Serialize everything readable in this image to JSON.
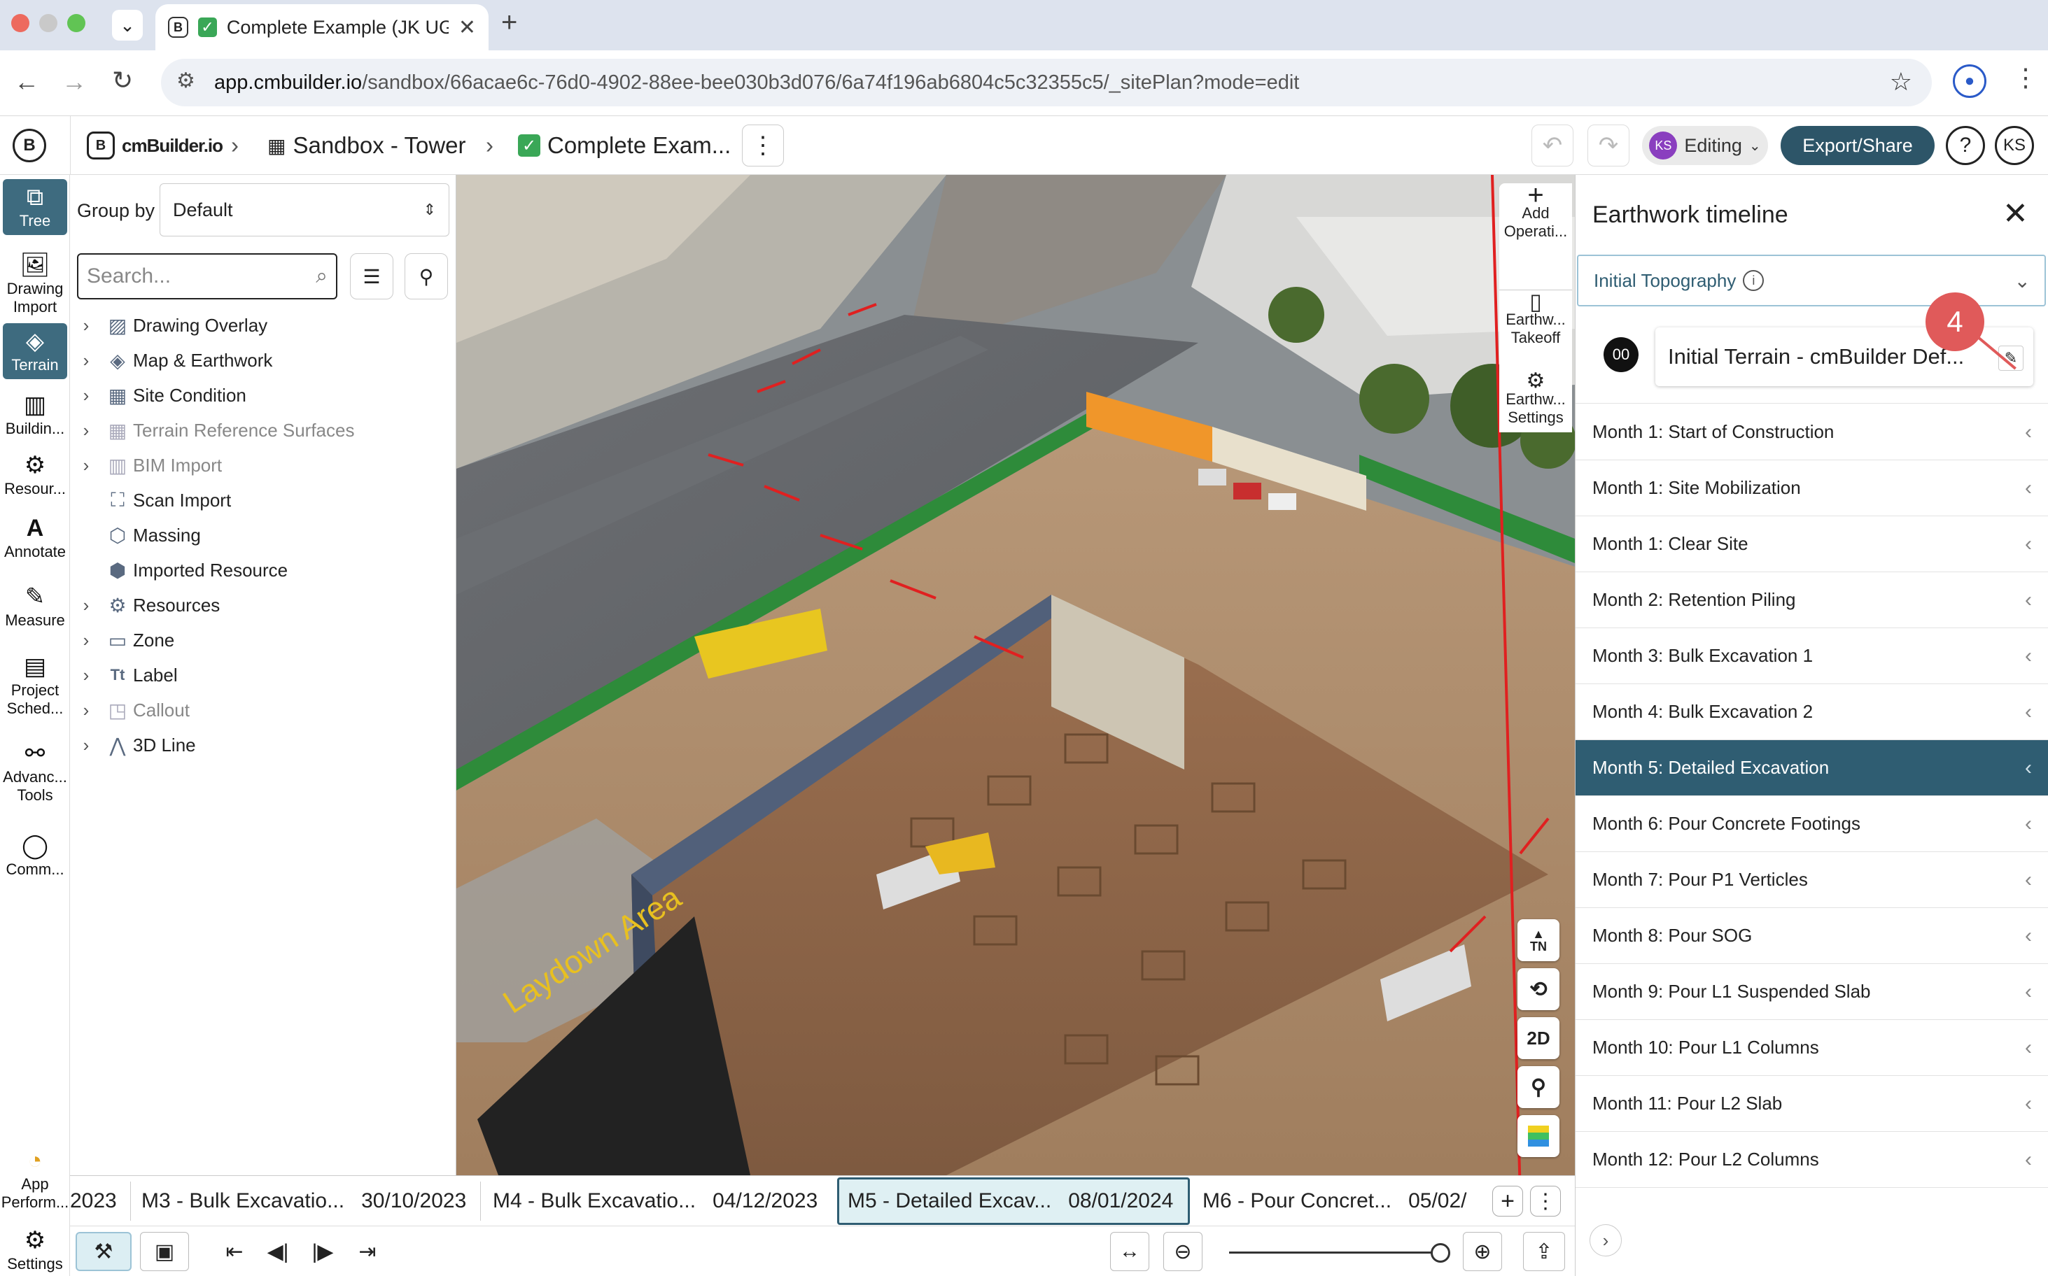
{
  "browser": {
    "tab_title": "Complete Example (JK UG",
    "new_tab": "+",
    "url_host": "app.cmbuilder.io",
    "url_path": "/sandbox/66acae6c-76d0-4902-88ee-bee030b3d076/6a74f196ab6804c5c32355c5/_sitePlan?mode=edit"
  },
  "header": {
    "logo": "cmBuilder.io",
    "crumbs": [
      "Sandbox - Tower",
      "Complete Exam..."
    ],
    "editing": "Editing",
    "avatar_ks": "KS",
    "export": "Export/Share",
    "help": "?",
    "user": "KS"
  },
  "rail": {
    "items": [
      {
        "label": "Tree"
      },
      {
        "label": "Drawing Import"
      },
      {
        "label": "Terrain"
      },
      {
        "label": "Buildin..."
      },
      {
        "label": "Resour..."
      },
      {
        "label": "Annotate"
      },
      {
        "label": "Measure"
      },
      {
        "label": "Project Sched..."
      },
      {
        "label": "Advanc... Tools"
      },
      {
        "label": "Comm..."
      }
    ],
    "app_perf": "App Perform...",
    "settings": "Settings"
  },
  "tree": {
    "groupby_label": "Group by",
    "groupby_value": "Default",
    "search_placeholder": "Search...",
    "items": [
      {
        "label": "Drawing Overlay"
      },
      {
        "label": "Map & Earthwork"
      },
      {
        "label": "Site Condition"
      },
      {
        "label": "Terrain Reference Surfaces"
      },
      {
        "label": "BIM Import"
      },
      {
        "label": "Scan Import"
      },
      {
        "label": "Massing"
      },
      {
        "label": "Imported Resource"
      },
      {
        "label": "Resources"
      },
      {
        "label": "Zone"
      },
      {
        "label": "Label"
      },
      {
        "label": "Callout"
      },
      {
        "label": "3D Line"
      }
    ]
  },
  "viewport": {
    "laydown": "Laydown Area",
    "tools": [
      {
        "label": "Add Operati..."
      },
      {
        "label": "Earthw... Takeoff"
      },
      {
        "label": "Earthw... Settings"
      }
    ],
    "north": "TN",
    "mode2d": "2D"
  },
  "panel": {
    "title": "Earthwork timeline",
    "dropdown": "Initial Topography",
    "badge": "00",
    "terrain_name": "Initial Terrain - cmBuilder Def...",
    "step_marker": "4",
    "months": [
      "Month 1: Start of Construction",
      "Month 1: Site Mobilization",
      "Month 1: Clear Site",
      "Month 2: Retention Piling",
      "Month 3: Bulk Excavation 1",
      "Month 4: Bulk Excavation 2",
      "Month 5: Detailed Excavation",
      "Month 6: Pour Concrete Footings",
      "Month 7: Pour P1 Verticles",
      "Month 8: Pour SOG",
      "Month 9: Pour L1 Suspended Slab",
      "Month 10: Pour L1 Columns",
      "Month 11: Pour L2 Slab",
      "Month 12: Pour L2 Columns"
    ],
    "active_index": 6
  },
  "timeline": {
    "phases": [
      {
        "name": "",
        "date": "2023"
      },
      {
        "name": "M3 - Bulk Excavatio...",
        "date": "30/10/2023"
      },
      {
        "name": "M4 - Bulk Excavatio...",
        "date": "04/12/2023"
      },
      {
        "name": "M5 - Detailed Excav...",
        "date": "08/01/2024"
      },
      {
        "name": "M6 - Pour Concret...",
        "date": "05/02/"
      }
    ]
  },
  "colors": {
    "accent": "#2f5d72",
    "export_bg": "#2d5568",
    "step_marker": "#e05a5a",
    "phase_active_bg": "#dff0f3",
    "rail_active": "#3e6b7f"
  }
}
